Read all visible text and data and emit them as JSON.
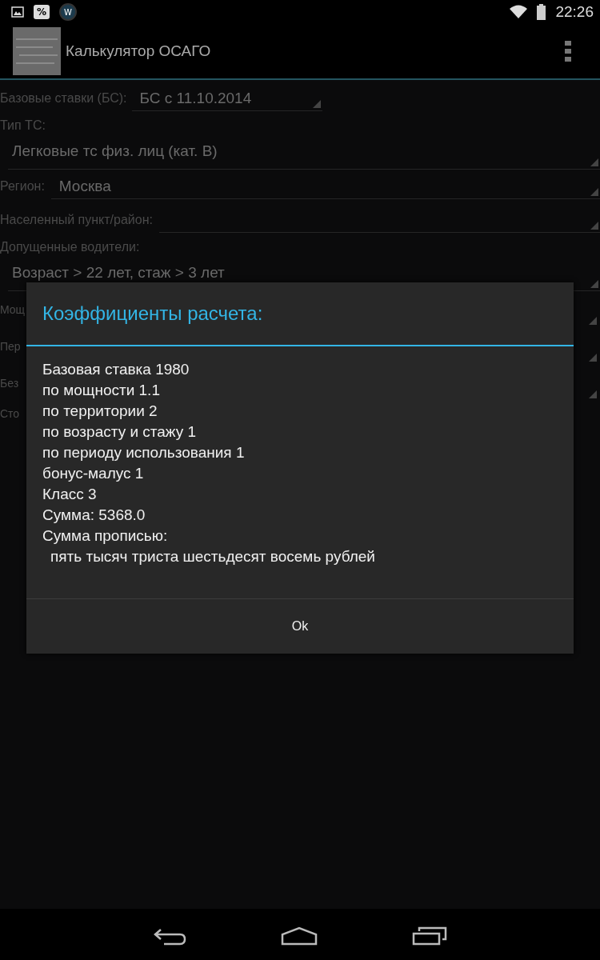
{
  "status_bar": {
    "time": "22:26",
    "notifications": [
      "%",
      "W"
    ]
  },
  "action_bar": {
    "title": "Калькулятор ОСАГО"
  },
  "form": [
    {
      "kind": "inline-short",
      "label": "Базовые ставки (БС):",
      "value": "БС с 11.10.2014"
    },
    {
      "kind": "stacked",
      "label": "Тип ТС:",
      "value": "Легковые тс физ. лиц (кат. В)"
    },
    {
      "kind": "inline",
      "label": "Регион:",
      "value": "Москва"
    },
    {
      "kind": "inline",
      "label": "Населенный пункт/район:"
    },
    {
      "kind": "stacked",
      "label": "Допущенные водители:",
      "value": "Возраст > 22 лет, стаж > 3 лет"
    },
    {
      "kind": "covered",
      "label": "Мощ"
    },
    {
      "kind": "covered",
      "label": "Пер"
    },
    {
      "kind": "covered",
      "label": "Без"
    },
    {
      "kind": "covered-plain",
      "label": "Сто"
    }
  ],
  "dialog": {
    "title": "Коэффициенты расчета:",
    "lines": [
      {
        "text": "Базовая ставка  1980"
      },
      {
        "text": "по мощности  1.1"
      },
      {
        "text": "по территории  2"
      },
      {
        "text": "по возрасту и стажу  1"
      },
      {
        "text": "по периоду использования  1"
      },
      {
        "text": "бонус-малус 1"
      },
      {
        "text": "Класс  3"
      },
      {
        "text": "Сумма:  5368.0"
      },
      {
        "text": "Сумма прописью:",
        "children": [
          {
            "text": "пять тысяч триста шестьдесят восемь рублей"
          }
        ]
      }
    ],
    "buttons": [
      "Ok"
    ]
  }
}
